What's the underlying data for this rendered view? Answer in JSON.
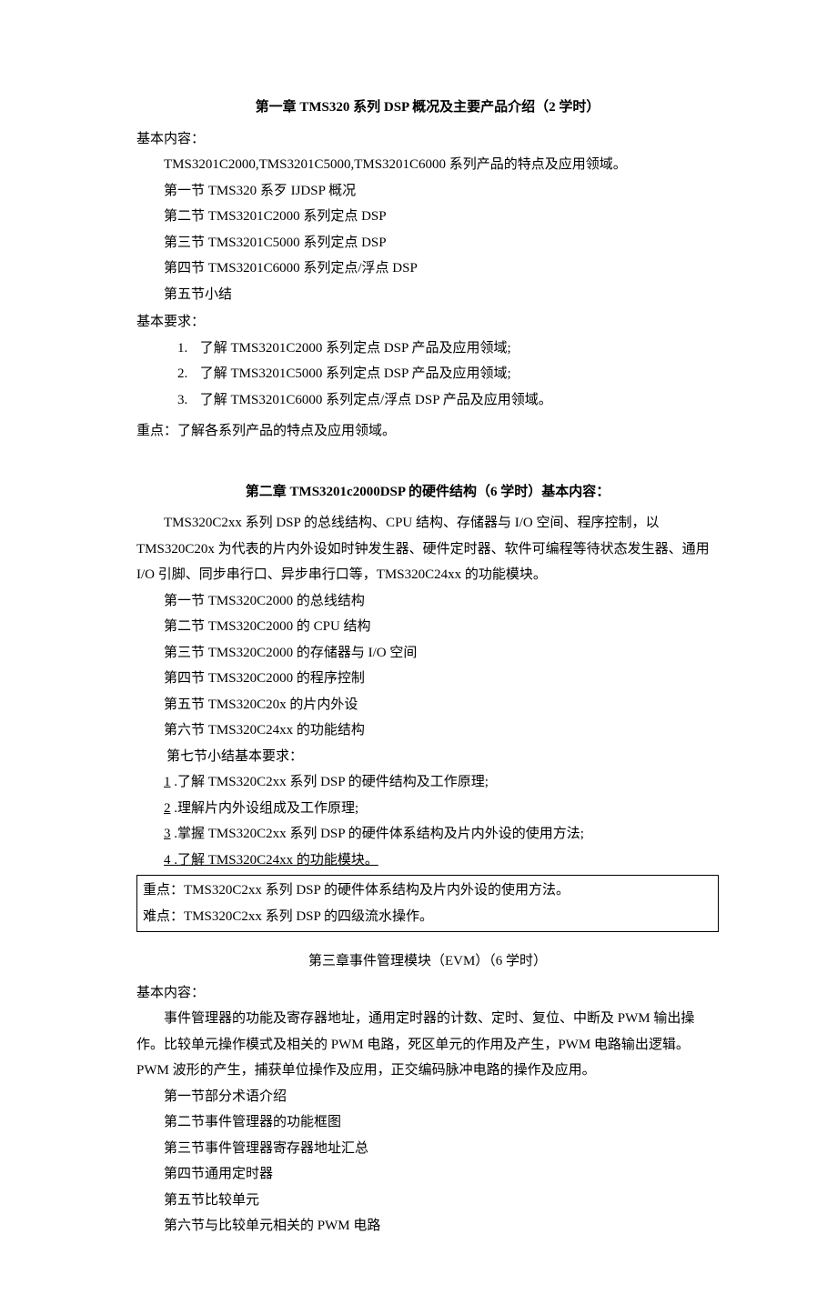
{
  "ch1": {
    "title": "第一章 TMS320 系列 DSP 概况及主要产品介绍（2 学时）",
    "basic_content_label": "基本内容：",
    "intro": "TMS3201C2000,TMS3201C5000,TMS3201C6000 系列产品的特点及应用领域。",
    "sections": [
      "第一节 TMS320 系歹 IJDSP 概况",
      "第二节 TMS3201C2000 系列定点 DSP",
      "第三节 TMS3201C5000 系列定点 DSP",
      "第四节 TMS3201C6000 系列定点/浮点 DSP",
      "第五节小结"
    ],
    "basic_req_label": "基本要求：",
    "reqs": [
      "了解 TMS3201C2000 系列定点 DSP 产品及应用领域;",
      "了解 TMS3201C5000 系列定点 DSP 产品及应用领域;",
      "了解 TMS3201C6000 系列定点/浮点 DSP 产品及应用领域。"
    ],
    "focus": "重点：了解各系列产品的特点及应用领域。"
  },
  "ch2": {
    "title": "第二章 TMS3201c2000DSP 的硬件结构（6 学时）基本内容：",
    "body": "TMS320C2xx 系列 DSP 的总线结构、CPU 结构、存储器与 I/O 空间、程序控制，以 TMS320C20x 为代表的片内外设如时钟发生器、硬件定时器、软件可编程等待状态发生器、通用 I/O 引脚、同步串行口、异步串行口等，TMS320C24xx 的功能模块。",
    "sections": [
      "第一节 TMS320C2000 的总线结构",
      "第二节 TMS320C2000 的 CPU 结构",
      "第三节 TMS320C2000 的存储器与 I/O 空间",
      "第四节 TMS320C2000 的程序控制",
      "第五节 TMS320C20x 的片内外设",
      "第六节 TMS320C24xx 的功能结构",
      "第七节小结基本要求："
    ],
    "reqs": [
      ".了解 TMS320C2xx 系列 DSP 的硬件结构及工作原理;",
      ".理解片内外设组成及工作原理;",
      ".掌握 TMS320C2xx 系列 DSP 的硬件体系结构及片内外设的使用方法;"
    ],
    "req4_prefix": "4",
    "req4_text": " .了解 TMS320C24xx 的功能模块。",
    "box_focus": "重点：TMS320C2xx 系列 DSP 的硬件体系结构及片内外设的使用方法。",
    "box_diff": "难点：TMS320C2xx 系列 DSP 的四级流水操作。"
  },
  "ch3": {
    "title": "第三章事件管理模块（EVM）（6 学时）",
    "basic_content_label": "基本内容：",
    "body": "事件管理器的功能及寄存器地址，通用定时器的计数、定时、复位、中断及 PWM 输出操作。比较单元操作模式及相关的 PWM 电路，死区单元的作用及产生，PWM 电路输出逻辑。PWM 波形的产生，捕获单位操作及应用，正交编码脉冲电路的操作及应用。",
    "sections": [
      "第一节部分术语介绍",
      "第二节事件管理器的功能框图",
      "第三节事件管理器寄存器地址汇总",
      "第四节通用定时器",
      "第五节比较单元",
      "第六节与比较单元相关的 PWM 电路"
    ]
  },
  "nums": {
    "n1": "1.",
    "n2": "2.",
    "n3": "3.",
    "u1": "1",
    "u2": "2",
    "u3": "3"
  }
}
